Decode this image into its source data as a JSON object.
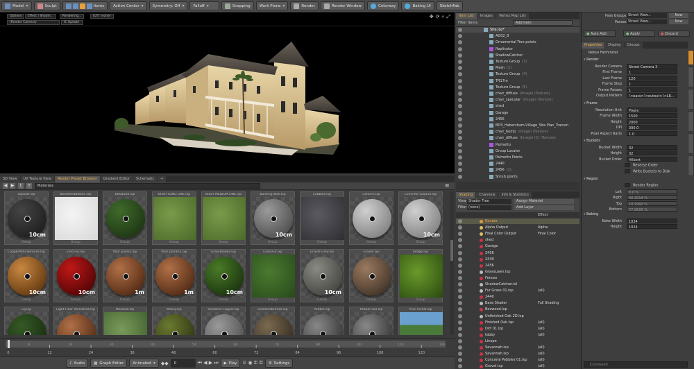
{
  "toolbar": {
    "model": "Model",
    "sculpt": "Sculpt",
    "items": "Items",
    "action_center": "Action Center",
    "symmetry": "Symmetry: Off",
    "falloff": "Falloff",
    "snapping": "Snapping",
    "work_plane": "Work Plane",
    "render": "Render",
    "render_window": "Render Window",
    "colorway": "Colorway",
    "baking_ui": "Baking UI",
    "sketchfab": "SketchFab"
  },
  "viewport": {
    "options": "Options",
    "effect": "Effect | Shadin...",
    "rendering": "Rendering...",
    "lut": "LUT: (none)",
    "render_camera": "(Render Camera)",
    "ic_update": "IC Update"
  },
  "lower_tabs": [
    "3D View",
    "UV Texture View",
    "Render Preset Browser",
    "Gradient Editor",
    "Schematic"
  ],
  "preset_browser": {
    "path": "Materials",
    "presets": [
      {
        "name": "asphalt.lxp",
        "cat": "Group",
        "tone": "dark",
        "scale": "10cm"
      },
      {
        "name": "BoardAndBatten.lxp",
        "cat": "Group",
        "tone": "white",
        "scale": ""
      },
      {
        "name": "Boxwood.lxp",
        "cat": "Group",
        "tone": "bush",
        "scale": ""
      },
      {
        "name": "BUSH LONG ONE.lxp",
        "cat": "Group",
        "tone": "grass",
        "scale": ""
      },
      {
        "name": "BUSH MEDIUM ONE.lxp",
        "cat": "Group",
        "tone": "grass",
        "scale": ""
      },
      {
        "name": "Building Wall.lxp",
        "cat": "Group",
        "tone": "grey",
        "scale": "10cm"
      },
      {
        "name": "Cobbles.lxp",
        "cat": "Group",
        "tone": "stone",
        "scale": ""
      },
      {
        "name": "Column.lxp",
        "cat": "Group",
        "tone": "lightgrey",
        "scale": ""
      },
      {
        "name": "Concrete Ground.lxp",
        "cat": "Group",
        "tone": "lightgrey",
        "scale": "10cm"
      },
      {
        "name": "CopperPatinaBronze.lxp",
        "cat": "Group",
        "tone": "copper",
        "scale": "10cm"
      },
      {
        "name": "Emo Fur.lxp",
        "cat": "Group",
        "tone": "red",
        "scale": "10cm"
      },
      {
        "name": "floor planks.lxp",
        "cat": "Group",
        "tone": "wood",
        "scale": "1m"
      },
      {
        "name": "floor planks2.lxp",
        "cat": "Group",
        "tone": "wood",
        "scale": "1m"
      },
      {
        "name": "GrassBlades.lxp",
        "cat": "Group",
        "tone": "green",
        "scale": "10cm"
      },
      {
        "name": "GrassFur.lxp",
        "cat": "Group",
        "tone": "field",
        "scale": ""
      },
      {
        "name": "Gravel Grey.lxp",
        "cat": "Group",
        "tone": "gravel",
        "scale": "10cm"
      },
      {
        "name": "Gravel.lxp",
        "cat": "Group",
        "tone": "gravelbrown",
        "scale": ""
      },
      {
        "name": "hedge.lxp",
        "cat": "Group",
        "tone": "hedge",
        "scale": ""
      },
      {
        "name": "ivy.lxp",
        "cat": "",
        "tone": "ivy",
        "scale": ""
      },
      {
        "name": "Light Floor Varnished.lxp",
        "cat": "",
        "tone": "wood",
        "scale": ""
      },
      {
        "name": "Meadow.lxp",
        "cat": "",
        "tone": "meadow",
        "scale": ""
      },
      {
        "name": "Mossy.lxp",
        "cat": "",
        "tone": "moss",
        "scale": ""
      },
      {
        "name": "Oxidized Copper.lxp",
        "cat": "",
        "tone": "grey",
        "scale": ""
      },
      {
        "name": "OxidizedBronze.lxp",
        "cat": "",
        "tone": "bronze",
        "scale": ""
      },
      {
        "name": "Pebble.lxp",
        "cat": "",
        "tone": "pebble",
        "scale": ""
      },
      {
        "name": "Pebble Soil.lxp",
        "cat": "",
        "tone": "pebble",
        "scale": ""
      },
      {
        "name": "Pine Forest.lxp",
        "cat": "",
        "tone": "forest",
        "scale": ""
      }
    ]
  },
  "timeline": {
    "ticks": [
      "0",
      "12",
      "24",
      "36",
      "48",
      "60",
      "72",
      "84",
      "96",
      "108",
      "120"
    ],
    "ticks2": [
      "6",
      "18",
      "30",
      "42",
      "54",
      "66",
      "78",
      "90",
      "102",
      "114",
      "126"
    ],
    "end": "120"
  },
  "bottombar": {
    "audio": "Audio",
    "graph_editor": "Graph Editor",
    "animated": "Animated",
    "frame": "0",
    "play": "Play",
    "settings": "Settings"
  },
  "item_list": {
    "tabs": [
      "Item List",
      "Images",
      "Vertex Map List"
    ],
    "filter": "Filter Items",
    "add_item": "Add Item",
    "items": [
      {
        "name": "Site.lxo*",
        "extra": ""
      },
      {
        "name": "AG02_8",
        "extra": ""
      },
      {
        "name": "Ornamental Tree points",
        "extra": ""
      },
      {
        "name": "Replicator",
        "extra": ""
      },
      {
        "name": "ShadowCatcher",
        "extra": ""
      },
      {
        "name": "Texture Group",
        "extra": "(3)"
      },
      {
        "name": "Mesh",
        "extra": "(2)"
      },
      {
        "name": "Texture Group",
        "extra": "(4)"
      },
      {
        "name": "TR17m",
        "extra": ""
      },
      {
        "name": "Texture Group",
        "extra": "(5)"
      },
      {
        "name": "chair_diffuse",
        "extra": "(Image) (Texture)"
      },
      {
        "name": "chair_specular",
        "extra": "(Image) (Texture)"
      },
      {
        "name": "shed",
        "extra": ""
      },
      {
        "name": "Garage",
        "extra": ""
      },
      {
        "name": "2456",
        "extra": ""
      },
      {
        "name": "BDS_Habersham-Village_Site Plan_Transm",
        "extra": ""
      },
      {
        "name": "chair_bump",
        "extra": "(Image) (Texture)"
      },
      {
        "name": "chair_diffuse",
        "extra": "(Image) (2) (Texture)"
      },
      {
        "name": "Palmetto",
        "extra": ""
      },
      {
        "name": "Group Locator",
        "extra": ""
      },
      {
        "name": "Palmetto Points",
        "extra": ""
      },
      {
        "name": "2440",
        "extra": ""
      },
      {
        "name": "2456",
        "extra": "(2)"
      },
      {
        "name": "Shrub points",
        "extra": ""
      }
    ]
  },
  "shading": {
    "tabs": [
      "Shading",
      "Channels",
      "Info & Statistics"
    ],
    "view_label": "View",
    "view_value": "Shader Tree",
    "assign_material": "Assign Material",
    "filter_label": "Filter",
    "filter_value": "(none)",
    "add_layer": "Add Layer",
    "col_effect": "Effect",
    "rows": [
      {
        "name": "Render",
        "effect": ""
      },
      {
        "name": "Alpha Output",
        "effect": "Alpha"
      },
      {
        "name": "Final Color Output",
        "effect": "Final Color"
      },
      {
        "name": "shed",
        "effect": ""
      },
      {
        "name": "Garage",
        "effect": ""
      },
      {
        "name": "2456",
        "effect": ""
      },
      {
        "name": "2440",
        "effect": ""
      },
      {
        "name": "2456",
        "effect": ""
      },
      {
        "name": "GrassLawn.lxp",
        "effect": ""
      },
      {
        "name": "Fences",
        "effect": ""
      },
      {
        "name": "ShadowCatcher.lxl",
        "effect": ""
      },
      {
        "name": "Fur Grass 01.lxp",
        "effect": "(all)"
      },
      {
        "name": "2440",
        "effect": ""
      },
      {
        "name": "Base Shader",
        "effect": "Full Shading"
      },
      {
        "name": "Boxwood.lxp",
        "effect": ""
      },
      {
        "name": "Unfinished Oak 2D.lxp",
        "effect": ""
      },
      {
        "name": "Finished Oak.lxp",
        "effect": "(all)"
      },
      {
        "name": "Dirt 01.lxp",
        "effect": "(all)"
      },
      {
        "name": "tabby",
        "effect": "(all)"
      },
      {
        "name": "Linope",
        "effect": ""
      },
      {
        "name": "Savannah.lxp",
        "effect": "(all)"
      },
      {
        "name": "Savannah.lxp",
        "effect": "(all)"
      },
      {
        "name": "Concrete Pebbles 01.lxp",
        "effect": "(all)"
      },
      {
        "name": "Gravel.lxp",
        "effect": "(all)"
      }
    ]
  },
  "right_panel": {
    "pass_groups_label": "Pass Groups",
    "pass_groups_value": "Street View...",
    "passes_label": "Passes",
    "passes_value": "Street View...",
    "new": "New",
    "auto_add": "Auto Add",
    "apply": "Apply",
    "discard": "Discard",
    "tabs": [
      "Properties",
      "Display",
      "Groups"
    ],
    "rebus": "Rebus Farminizer",
    "sections": {
      "render": "Render",
      "frame": "Frame",
      "buckets": "Buckets",
      "region": "Region",
      "baking": "Baking"
    },
    "render_props": [
      {
        "label": "Render Camera",
        "value": "Street Camera 3"
      },
      {
        "label": "First Frame",
        "value": "1"
      },
      {
        "label": "Last Frame",
        "value": "120"
      },
      {
        "label": "Frame Step",
        "value": "1"
      },
      {
        "label": "Frame Passes",
        "value": "1"
      },
      {
        "label": "Output Pattern",
        "value": "[<pass>]<output>[<LR..."
      }
    ],
    "frame_props": [
      {
        "label": "Resolution Unit",
        "value": "Pixels"
      },
      {
        "label": "Frame Width",
        "value": "1500"
      },
      {
        "label": "Height",
        "value": "2000"
      },
      {
        "label": "DPI",
        "value": "300.0"
      },
      {
        "label": "Pixel Aspect Ratio",
        "value": "1.0"
      }
    ],
    "bucket_props": [
      {
        "label": "Bucket Width",
        "value": "32"
      },
      {
        "label": "Height",
        "value": "32"
      },
      {
        "label": "Bucket Order",
        "value": "Hilbert"
      }
    ],
    "reverse_order": "Reverse Order",
    "write_buckets": "Write Buckets to Disk",
    "render_region": "Render Region",
    "region_props": [
      {
        "label": "Left",
        "value": "0.0 %"
      },
      {
        "label": "Right",
        "value": "40.3214 %"
      },
      {
        "label": "Top",
        "value": "10.2992 %"
      },
      {
        "label": "Bottom",
        "value": "77.9505 %"
      }
    ],
    "baking_props": [
      {
        "label": "Bake Width",
        "value": "1024"
      },
      {
        "label": "Height",
        "value": "1024"
      }
    ],
    "command": "Command"
  },
  "colors": {
    "accent": "#f0b050",
    "selection": "#5a6f8f"
  }
}
